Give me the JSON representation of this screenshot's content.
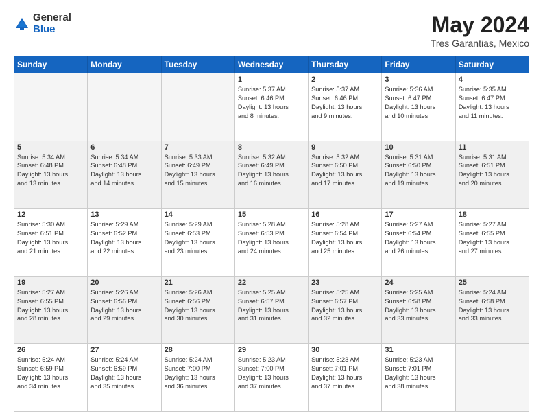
{
  "header": {
    "logo_general": "General",
    "logo_blue": "Blue",
    "title": "May 2024",
    "location": "Tres Garantias, Mexico"
  },
  "days_of_week": [
    "Sunday",
    "Monday",
    "Tuesday",
    "Wednesday",
    "Thursday",
    "Friday",
    "Saturday"
  ],
  "weeks": [
    [
      {
        "day": "",
        "info": ""
      },
      {
        "day": "",
        "info": ""
      },
      {
        "day": "",
        "info": ""
      },
      {
        "day": "1",
        "info": "Sunrise: 5:37 AM\nSunset: 6:46 PM\nDaylight: 13 hours\nand 8 minutes."
      },
      {
        "day": "2",
        "info": "Sunrise: 5:37 AM\nSunset: 6:46 PM\nDaylight: 13 hours\nand 9 minutes."
      },
      {
        "day": "3",
        "info": "Sunrise: 5:36 AM\nSunset: 6:47 PM\nDaylight: 13 hours\nand 10 minutes."
      },
      {
        "day": "4",
        "info": "Sunrise: 5:35 AM\nSunset: 6:47 PM\nDaylight: 13 hours\nand 11 minutes."
      }
    ],
    [
      {
        "day": "5",
        "info": "Sunrise: 5:34 AM\nSunset: 6:48 PM\nDaylight: 13 hours\nand 13 minutes."
      },
      {
        "day": "6",
        "info": "Sunrise: 5:34 AM\nSunset: 6:48 PM\nDaylight: 13 hours\nand 14 minutes."
      },
      {
        "day": "7",
        "info": "Sunrise: 5:33 AM\nSunset: 6:49 PM\nDaylight: 13 hours\nand 15 minutes."
      },
      {
        "day": "8",
        "info": "Sunrise: 5:32 AM\nSunset: 6:49 PM\nDaylight: 13 hours\nand 16 minutes."
      },
      {
        "day": "9",
        "info": "Sunrise: 5:32 AM\nSunset: 6:50 PM\nDaylight: 13 hours\nand 17 minutes."
      },
      {
        "day": "10",
        "info": "Sunrise: 5:31 AM\nSunset: 6:50 PM\nDaylight: 13 hours\nand 19 minutes."
      },
      {
        "day": "11",
        "info": "Sunrise: 5:31 AM\nSunset: 6:51 PM\nDaylight: 13 hours\nand 20 minutes."
      }
    ],
    [
      {
        "day": "12",
        "info": "Sunrise: 5:30 AM\nSunset: 6:51 PM\nDaylight: 13 hours\nand 21 minutes."
      },
      {
        "day": "13",
        "info": "Sunrise: 5:29 AM\nSunset: 6:52 PM\nDaylight: 13 hours\nand 22 minutes."
      },
      {
        "day": "14",
        "info": "Sunrise: 5:29 AM\nSunset: 6:53 PM\nDaylight: 13 hours\nand 23 minutes."
      },
      {
        "day": "15",
        "info": "Sunrise: 5:28 AM\nSunset: 6:53 PM\nDaylight: 13 hours\nand 24 minutes."
      },
      {
        "day": "16",
        "info": "Sunrise: 5:28 AM\nSunset: 6:54 PM\nDaylight: 13 hours\nand 25 minutes."
      },
      {
        "day": "17",
        "info": "Sunrise: 5:27 AM\nSunset: 6:54 PM\nDaylight: 13 hours\nand 26 minutes."
      },
      {
        "day": "18",
        "info": "Sunrise: 5:27 AM\nSunset: 6:55 PM\nDaylight: 13 hours\nand 27 minutes."
      }
    ],
    [
      {
        "day": "19",
        "info": "Sunrise: 5:27 AM\nSunset: 6:55 PM\nDaylight: 13 hours\nand 28 minutes."
      },
      {
        "day": "20",
        "info": "Sunrise: 5:26 AM\nSunset: 6:56 PM\nDaylight: 13 hours\nand 29 minutes."
      },
      {
        "day": "21",
        "info": "Sunrise: 5:26 AM\nSunset: 6:56 PM\nDaylight: 13 hours\nand 30 minutes."
      },
      {
        "day": "22",
        "info": "Sunrise: 5:25 AM\nSunset: 6:57 PM\nDaylight: 13 hours\nand 31 minutes."
      },
      {
        "day": "23",
        "info": "Sunrise: 5:25 AM\nSunset: 6:57 PM\nDaylight: 13 hours\nand 32 minutes."
      },
      {
        "day": "24",
        "info": "Sunrise: 5:25 AM\nSunset: 6:58 PM\nDaylight: 13 hours\nand 33 minutes."
      },
      {
        "day": "25",
        "info": "Sunrise: 5:24 AM\nSunset: 6:58 PM\nDaylight: 13 hours\nand 33 minutes."
      }
    ],
    [
      {
        "day": "26",
        "info": "Sunrise: 5:24 AM\nSunset: 6:59 PM\nDaylight: 13 hours\nand 34 minutes."
      },
      {
        "day": "27",
        "info": "Sunrise: 5:24 AM\nSunset: 6:59 PM\nDaylight: 13 hours\nand 35 minutes."
      },
      {
        "day": "28",
        "info": "Sunrise: 5:24 AM\nSunset: 7:00 PM\nDaylight: 13 hours\nand 36 minutes."
      },
      {
        "day": "29",
        "info": "Sunrise: 5:23 AM\nSunset: 7:00 PM\nDaylight: 13 hours\nand 37 minutes."
      },
      {
        "day": "30",
        "info": "Sunrise: 5:23 AM\nSunset: 7:01 PM\nDaylight: 13 hours\nand 37 minutes."
      },
      {
        "day": "31",
        "info": "Sunrise: 5:23 AM\nSunset: 7:01 PM\nDaylight: 13 hours\nand 38 minutes."
      },
      {
        "day": "",
        "info": ""
      }
    ]
  ]
}
